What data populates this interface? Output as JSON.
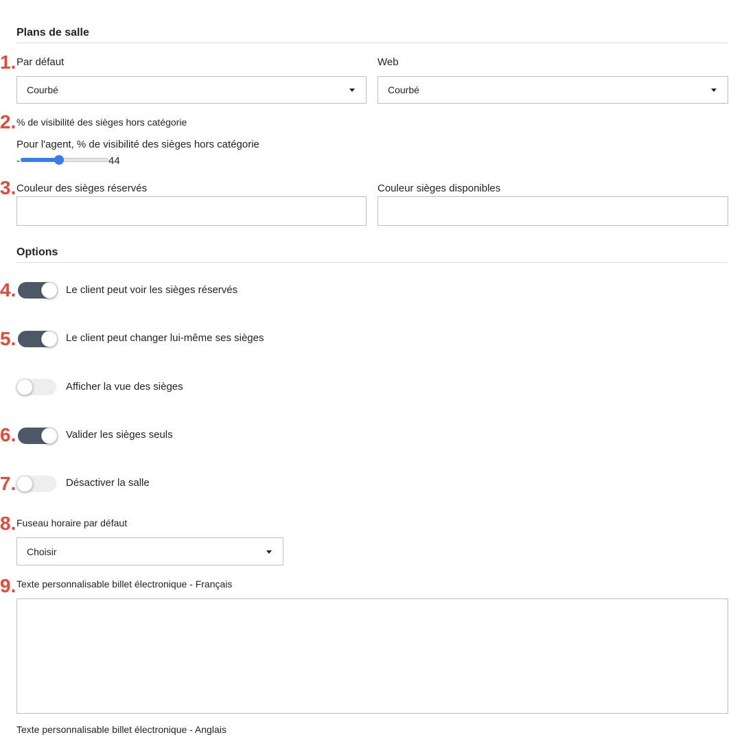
{
  "seat_plans": {
    "title": "Plans de salle",
    "default_label": "Par défaut",
    "default_value": "Courbé",
    "web_label": "Web",
    "web_value": "Courbé",
    "visibility_label": "% de visibilité des sièges hors catégorie",
    "agent_visibility_label": "Pour l'agent, % de visibilité des sièges hors catégorie",
    "slider_min_text": "-",
    "slider_value": "44",
    "slider_fraction": 0.44,
    "reserved_color_label": "Couleur des sièges réservés",
    "reserved_color_value": "",
    "available_color_label": "Couleur sièges disponibles",
    "available_color_value": ""
  },
  "options": {
    "title": "Options",
    "toggles": [
      {
        "label": "Le client peut voir les sièges réservés",
        "on": true
      },
      {
        "label": "Le client peut changer lui-même ses sièges",
        "on": true
      },
      {
        "label": "Afficher la vue des sièges",
        "on": false
      },
      {
        "label": "Valider les sièges seuls",
        "on": true
      },
      {
        "label": "Désactiver la salle",
        "on": false
      }
    ],
    "timezone_label": "Fuseau horaire par défaut",
    "timezone_value": "Choisir",
    "ticket_text_fr_label": "Texte personnalisable billet électronique - Français",
    "ticket_text_fr_value": "",
    "ticket_text_en_label": "Texte personnalisable billet électronique - Anglais"
  },
  "markers": [
    "1.",
    "2.",
    "3.",
    "4.",
    "5.",
    "6.",
    "7.",
    "8.",
    "9."
  ],
  "colors": {
    "marker": "#e5493a",
    "toggle_on": "#4f5866",
    "slider_accent": "#3b7ce8"
  }
}
